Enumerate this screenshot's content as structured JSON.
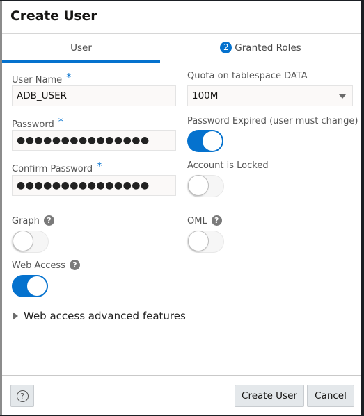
{
  "dialog": {
    "title": "Create User"
  },
  "tabs": [
    {
      "label": "User",
      "active": true
    },
    {
      "label": "Granted Roles",
      "badge": "2",
      "active": false
    }
  ],
  "form": {
    "user_name": {
      "label": "User Name",
      "required_mark": "*",
      "value": "ADB_USER"
    },
    "password": {
      "label": "Password",
      "required_mark": "*",
      "value": "●●●●●●●●●●●●●●●"
    },
    "confirm_password": {
      "label": "Confirm Password",
      "required_mark": "*",
      "value": "●●●●●●●●●●●●●●●"
    },
    "quota": {
      "label": "Quota on tablespace DATA",
      "value": "100M"
    },
    "password_expired": {
      "label": "Password Expired (user must change)",
      "on": true
    },
    "account_locked": {
      "label": "Account is Locked",
      "on": false
    },
    "graph": {
      "label": "Graph",
      "help": "?",
      "on": false
    },
    "oml": {
      "label": "OML",
      "help": "?",
      "on": false
    },
    "web_access": {
      "label": "Web Access",
      "help": "?",
      "on": true
    },
    "advanced": {
      "label": "Web access advanced features",
      "expanded": false
    }
  },
  "footer": {
    "help_label": "?",
    "create_label": "Create User",
    "cancel_label": "Cancel"
  },
  "colors": {
    "accent": "#0572ce"
  }
}
